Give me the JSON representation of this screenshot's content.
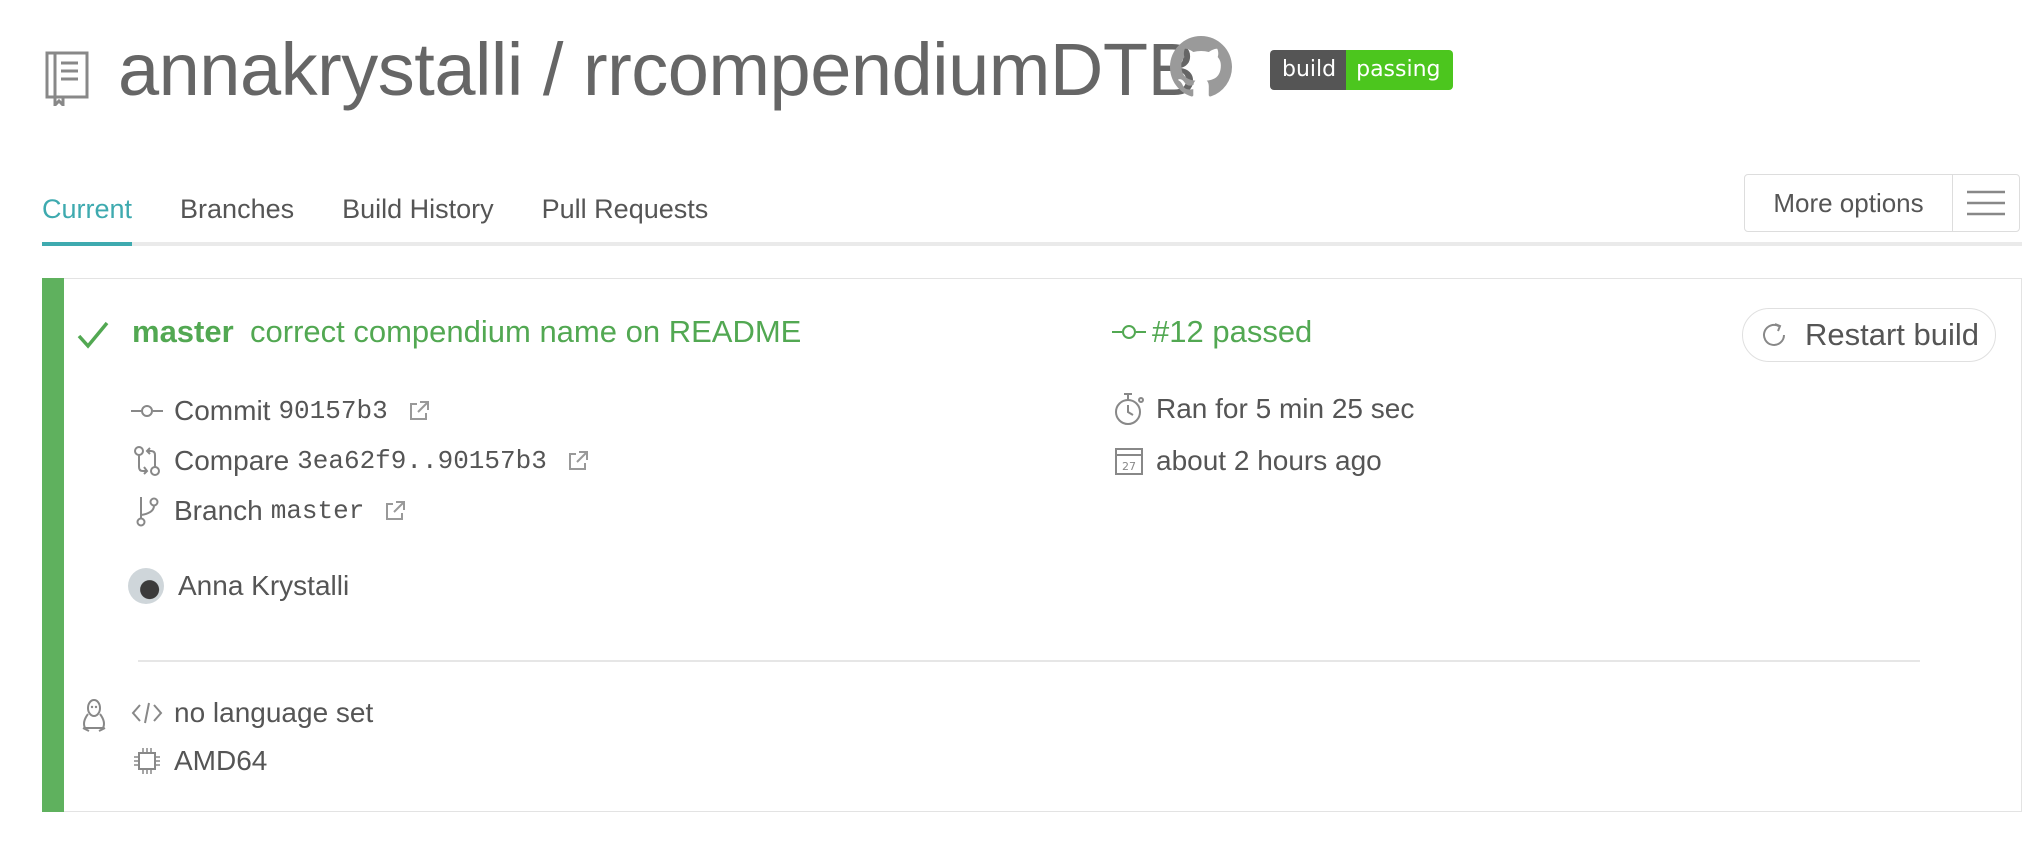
{
  "header": {
    "repo_title": "annakrystalli / rrcompendiumDTB",
    "badge": {
      "label": "build",
      "status": "passing"
    }
  },
  "tabs": [
    {
      "label": "Current",
      "active": true
    },
    {
      "label": "Branches",
      "active": false
    },
    {
      "label": "Build History",
      "active": false
    },
    {
      "label": "Pull Requests",
      "active": false
    }
  ],
  "more_options": {
    "label": "More options"
  },
  "build": {
    "status_color": "#52a852",
    "branch": "master",
    "commit_message": "correct compendium name on README",
    "number_text": "#12 passed",
    "restart_label": "Restart build",
    "commit": {
      "label": "Commit",
      "value": "90157b3"
    },
    "compare": {
      "label": "Compare",
      "value": "3ea62f9..90157b3"
    },
    "branch_row": {
      "label": "Branch",
      "value": "master"
    },
    "duration": "Ran for 5 min 25 sec",
    "finished": "about 2 hours ago",
    "calendar_day": "27",
    "author": "Anna Krystalli",
    "language": "no language set",
    "arch": "AMD64"
  },
  "icons": {
    "repo": "repo-book-icon",
    "github": "github-icon",
    "check": "check-icon",
    "commit": "commit-icon",
    "compare": "compare-icon",
    "branch": "branch-icon",
    "external": "external-link-icon",
    "stopwatch": "stopwatch-icon",
    "calendar": "calendar-icon",
    "linux": "linux-icon",
    "code": "code-icon",
    "cpu": "cpu-icon",
    "restart": "restart-icon",
    "menu": "hamburger-icon"
  }
}
